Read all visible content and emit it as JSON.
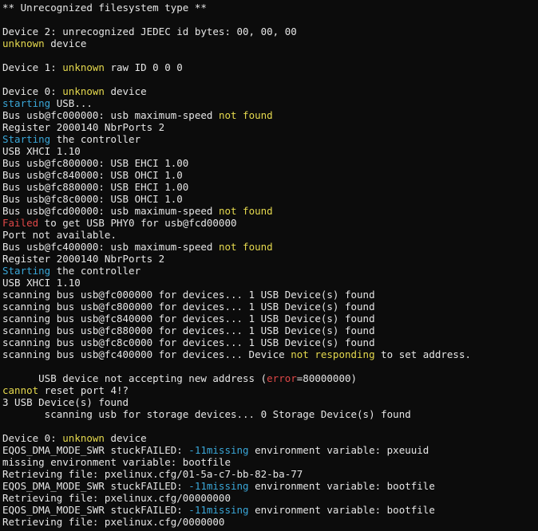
{
  "colors": {
    "background": "#0c0c0c",
    "default": "#e6e6e6",
    "yellow": "#e5d94e",
    "cyan": "#3aa7d8",
    "red": "#e04848"
  },
  "lines": [
    [
      {
        "t": "** Unrecognized filesystem type **"
      }
    ],
    [],
    [
      {
        "t": "Device 2: unrecognized JEDEC id bytes: 00, 00, 00"
      }
    ],
    [
      {
        "t": "unknown",
        "c": "yellow"
      },
      {
        "t": " device"
      }
    ],
    [],
    [
      {
        "t": "Device 1: "
      },
      {
        "t": "unknown",
        "c": "yellow"
      },
      {
        "t": " raw ID 0 0 0"
      }
    ],
    [],
    [
      {
        "t": "Device 0: "
      },
      {
        "t": "unknown",
        "c": "yellow"
      },
      {
        "t": " device"
      }
    ],
    [
      {
        "t": "starting",
        "c": "cyan"
      },
      {
        "t": " USB..."
      }
    ],
    [
      {
        "t": "Bus usb@fc000000: usb maximum-speed "
      },
      {
        "t": "not found",
        "c": "yellow"
      }
    ],
    [
      {
        "t": "Register 2000140 NbrPorts 2"
      }
    ],
    [
      {
        "t": "Starting",
        "c": "cyan"
      },
      {
        "t": " the controller"
      }
    ],
    [
      {
        "t": "USB XHCI 1.10"
      }
    ],
    [
      {
        "t": "Bus usb@fc800000: USB EHCI 1.00"
      }
    ],
    [
      {
        "t": "Bus usb@fc840000: USB OHCI 1.0"
      }
    ],
    [
      {
        "t": "Bus usb@fc880000: USB EHCI 1.00"
      }
    ],
    [
      {
        "t": "Bus usb@fc8c0000: USB OHCI 1.0"
      }
    ],
    [
      {
        "t": "Bus usb@fcd00000: usb maximum-speed "
      },
      {
        "t": "not found",
        "c": "yellow"
      }
    ],
    [
      {
        "t": "Failed",
        "c": "red"
      },
      {
        "t": " to get USB PHY0 for usb@fcd00000"
      }
    ],
    [
      {
        "t": "Port not available."
      }
    ],
    [
      {
        "t": "Bus usb@fc400000: usb maximum-speed "
      },
      {
        "t": "not found",
        "c": "yellow"
      }
    ],
    [
      {
        "t": "Register 2000140 NbrPorts 2"
      }
    ],
    [
      {
        "t": "Starting",
        "c": "cyan"
      },
      {
        "t": " the controller"
      }
    ],
    [
      {
        "t": "USB XHCI 1.10"
      }
    ],
    [
      {
        "t": "scanning bus usb@fc000000 for devices... 1 USB Device(s) found"
      }
    ],
    [
      {
        "t": "scanning bus usb@fc800000 for devices... 1 USB Device(s) found"
      }
    ],
    [
      {
        "t": "scanning bus usb@fc840000 for devices... 1 USB Device(s) found"
      }
    ],
    [
      {
        "t": "scanning bus usb@fc880000 for devices... 1 USB Device(s) found"
      }
    ],
    [
      {
        "t": "scanning bus usb@fc8c0000 for devices... 1 USB Device(s) found"
      }
    ],
    [
      {
        "t": "scanning bus usb@fc400000 for devices... Device "
      },
      {
        "t": "not responding",
        "c": "yellow"
      },
      {
        "t": " to set address."
      }
    ],
    [],
    [
      {
        "t": "      USB device not accepting new address ("
      },
      {
        "t": "error",
        "c": "red"
      },
      {
        "t": "=80000000)"
      }
    ],
    [
      {
        "t": "cannot",
        "c": "yellow"
      },
      {
        "t": " reset port 4!?"
      }
    ],
    [
      {
        "t": "3 USB Device(s) found"
      }
    ],
    [
      {
        "t": "       scanning usb for storage devices... 0 Storage Device(s) found"
      }
    ],
    [],
    [
      {
        "t": "Device 0: "
      },
      {
        "t": "unknown",
        "c": "yellow"
      },
      {
        "t": " device"
      }
    ],
    [
      {
        "t": "EQOS_DMA_MODE_SWR stuckFAILED: "
      },
      {
        "t": "-11missing",
        "c": "cyan"
      },
      {
        "t": " environment variable: pxeuuid"
      }
    ],
    [
      {
        "t": "missing environment variable: bootfile"
      }
    ],
    [
      {
        "t": "Retrieving file: pxelinux.cfg/01-5a-c7-bb-82-ba-77"
      }
    ],
    [
      {
        "t": "EQOS_DMA_MODE_SWR stuckFAILED: "
      },
      {
        "t": "-11missing",
        "c": "cyan"
      },
      {
        "t": " environment variable: bootfile"
      }
    ],
    [
      {
        "t": "Retrieving file: pxelinux.cfg/00000000"
      }
    ],
    [
      {
        "t": "EQOS_DMA_MODE_SWR stuckFAILED: "
      },
      {
        "t": "-11missing",
        "c": "cyan"
      },
      {
        "t": " environment variable: bootfile"
      }
    ],
    [
      {
        "t": "Retrieving file: pxelinux.cfg/0000000"
      }
    ]
  ]
}
